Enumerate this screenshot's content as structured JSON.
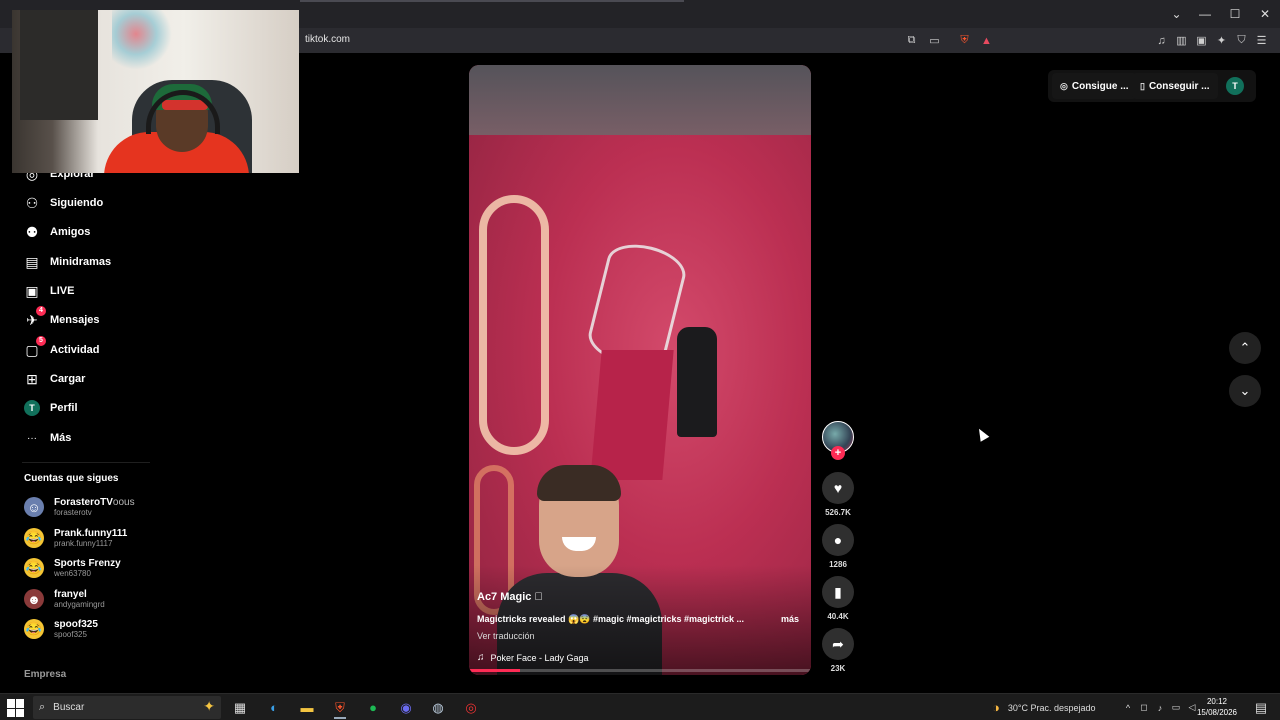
{
  "browser": {
    "url": "tiktok.com",
    "window_controls": {
      "chevron": "⌄",
      "minimize": "—",
      "maximize": "☐",
      "close": "✕"
    }
  },
  "sidebar": {
    "items": [
      {
        "label": "Explorar",
        "icon": "compass-icon",
        "glyph": "◎"
      },
      {
        "label": "Siguiendo",
        "icon": "following-icon",
        "glyph": "⚇"
      },
      {
        "label": "Amigos",
        "icon": "friends-icon",
        "glyph": "⚉"
      },
      {
        "label": "Minidramas",
        "icon": "film-icon",
        "glyph": "▤"
      },
      {
        "label": "LIVE",
        "icon": "live-icon",
        "glyph": "▣"
      },
      {
        "label": "Mensajes",
        "icon": "messages-icon",
        "glyph": "✈",
        "badge": "4"
      },
      {
        "label": "Actividad",
        "icon": "activity-icon",
        "glyph": "▢",
        "badge": "5"
      },
      {
        "label": "Cargar",
        "icon": "upload-icon",
        "glyph": "⊞"
      },
      {
        "label": "Perfil",
        "icon": "profile-icon",
        "avatar_letter": "T"
      },
      {
        "label": "Más",
        "icon": "more-icon",
        "glyph": "···"
      }
    ],
    "following_title": "Cuentas que sigues",
    "following": [
      {
        "name": "ForasteroTV",
        "suffix": "oous",
        "user": "forasterotv",
        "avatar_color": "#6a7fae",
        "glyph": "☺"
      },
      {
        "name": "Prank.funny111",
        "user": "prank.funny1117",
        "avatar_color": "#f4c534",
        "glyph": "😂"
      },
      {
        "name": "Sports Frenzy",
        "user": "wen63780",
        "avatar_color": "#f4c534",
        "glyph": "😂"
      },
      {
        "name": "franyel",
        "user": "andygamingrd",
        "avatar_color": "#8a3a3a",
        "glyph": "☻"
      },
      {
        "name": "spoof325",
        "user": "spoof325",
        "avatar_color": "#f4c534",
        "glyph": "😂"
      }
    ],
    "footer": "Empresa"
  },
  "video": {
    "author": "Ac7 Magic 􀀀",
    "description": "Magictricks revealed 😱😨 #magic #magictricks #magictrick ...",
    "more_label": "más",
    "translate_label": "Ver traducción",
    "music": "Poker Face - Lady Gaga",
    "progress": 0.15
  },
  "actions": {
    "likes": "526.7K",
    "comments": "1286",
    "saves": "40.4K",
    "shares": "23K"
  },
  "topright": {
    "btn1": "Consigue ...",
    "btn2": "Conseguir ...",
    "avatar_letter": "T"
  },
  "taskbar": {
    "search_placeholder": "Buscar",
    "weather": "30°C  Prac. despejado",
    "time": "20:12",
    "date": "15/08/2026"
  },
  "colors": {
    "accent": "#fe2c55",
    "avatar_green": "#11705b"
  }
}
